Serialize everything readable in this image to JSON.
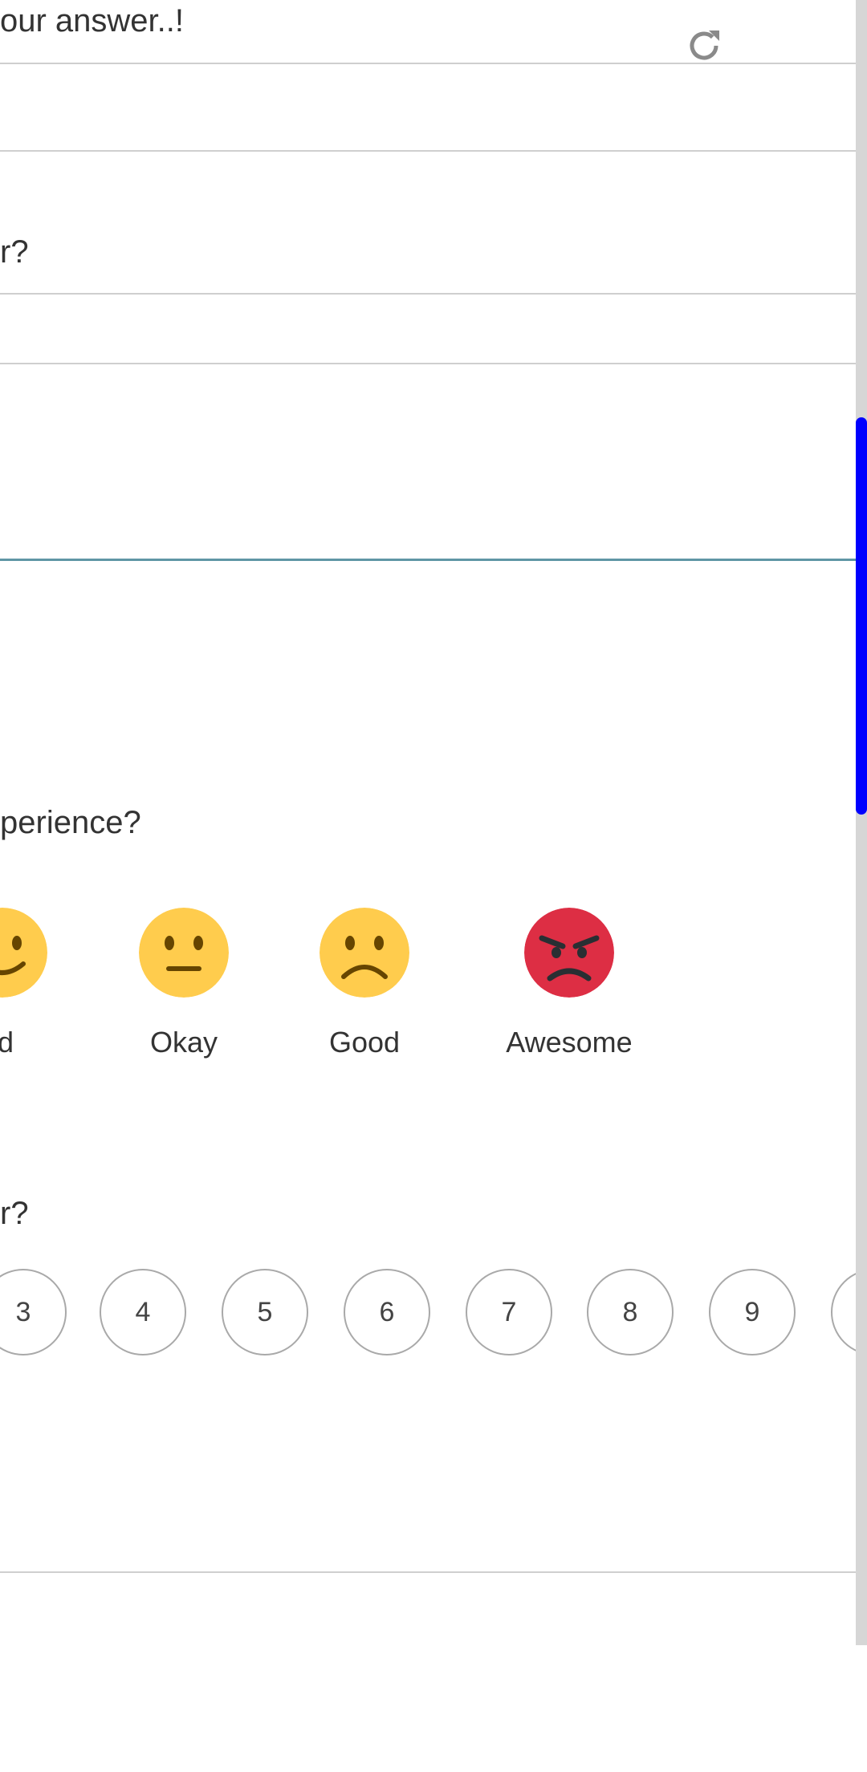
{
  "form": {
    "answer_placeholder_fragment": "our answer..!",
    "question_fragment_1": "r?",
    "experience_question_fragment": "perience?",
    "question_fragment_2": "r?"
  },
  "rating": {
    "emojis": [
      {
        "label": "ad",
        "icon": "slightly-smiling-face-icon",
        "color": "#FFCC4D"
      },
      {
        "label": "Okay",
        "icon": "neutral-face-icon",
        "color": "#FFCC4D"
      },
      {
        "label": "Good",
        "icon": "frowning-face-icon",
        "color": "#FFCC4D"
      },
      {
        "label": "Awesome",
        "icon": "angry-face-icon",
        "color": "#DD2E44"
      }
    ]
  },
  "scale": {
    "numbers": [
      "3",
      "4",
      "5",
      "6",
      "7",
      "8",
      "9"
    ]
  },
  "scrollbar": {
    "thumb_color": "#0000FF"
  }
}
